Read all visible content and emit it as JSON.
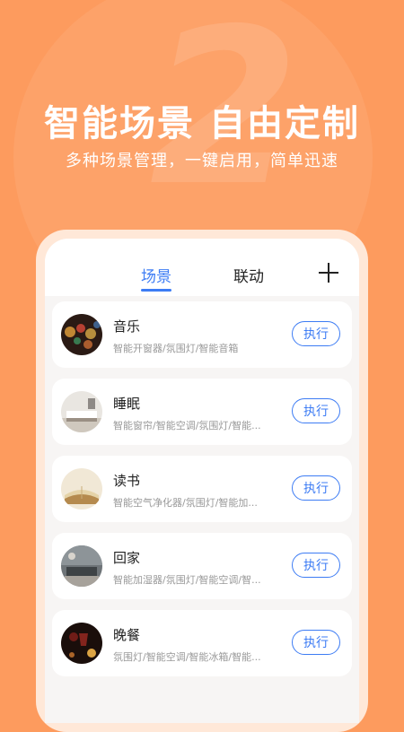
{
  "hero": {
    "digit": "2",
    "title": "智能场景 自由定制",
    "subtitle": "多种场景管理，一键启用，简单迅速"
  },
  "tabs": [
    {
      "label": "场景",
      "active": true
    },
    {
      "label": "联动",
      "active": false
    }
  ],
  "add_icon": "plus-icon",
  "scenes": [
    {
      "name": "音乐",
      "devices": "智能开窗器/氛围灯/智能音箱",
      "action": "执行",
      "image": "music-bokeh-image"
    },
    {
      "name": "睡眠",
      "devices": "智能窗帘/智能空调/氛围灯/智能...",
      "action": "执行",
      "image": "bedroom-image"
    },
    {
      "name": "读书",
      "devices": "智能空气净化器/氛围灯/智能加...",
      "action": "执行",
      "image": "book-image"
    },
    {
      "name": "回家",
      "devices": "智能加湿器/氛围灯/智能空调/智...",
      "action": "执行",
      "image": "living-room-image"
    },
    {
      "name": "晚餐",
      "devices": "氛围灯/智能空调/智能冰箱/智能...",
      "action": "执行",
      "image": "dinner-image"
    }
  ],
  "colors": {
    "background": "#FD9B5E",
    "accent": "#3D7CF4",
    "card": "#FFFFFF"
  }
}
